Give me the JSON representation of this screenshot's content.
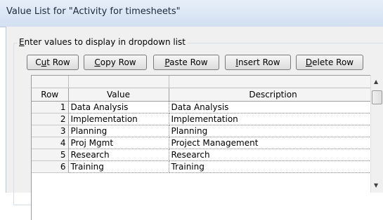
{
  "window": {
    "title": "Value List for \"Activity for timesheets\""
  },
  "group": {
    "caption_accel": "E",
    "caption_rest": "nter values to display in dropdown list"
  },
  "toolbar": {
    "cut": {
      "pre": "C",
      "accel": "u",
      "post": "t Row"
    },
    "copy": {
      "pre": "",
      "accel": "C",
      "post": "opy Row"
    },
    "paste": {
      "pre": "",
      "accel": "P",
      "post": "aste Row"
    },
    "insert": {
      "pre": "",
      "accel": "I",
      "post": "nsert Row"
    },
    "delete": {
      "pre": "",
      "accel": "D",
      "post": "elete Row"
    }
  },
  "grid": {
    "columns": [
      "Row",
      "Value",
      "Description"
    ],
    "rows": [
      {
        "row": "1",
        "value": "Data Analysis",
        "description": "Data Analysis"
      },
      {
        "row": "2",
        "value": "Implementation",
        "description": "Implementation"
      },
      {
        "row": "3",
        "value": "Planning",
        "description": "Planning"
      },
      {
        "row": "4",
        "value": "Proj Mgmt",
        "description": "Project Management"
      },
      {
        "row": "5",
        "value": "Research",
        "description": "Research"
      },
      {
        "row": "6",
        "value": "Training",
        "description": "Training"
      }
    ]
  },
  "icons": {
    "scroll_up": "▲",
    "scroll_down": "▼"
  },
  "colors": {
    "titlebar": "#dbe6f4",
    "panel": "#f0f0f0",
    "grid_header": "#f4f4f4"
  }
}
